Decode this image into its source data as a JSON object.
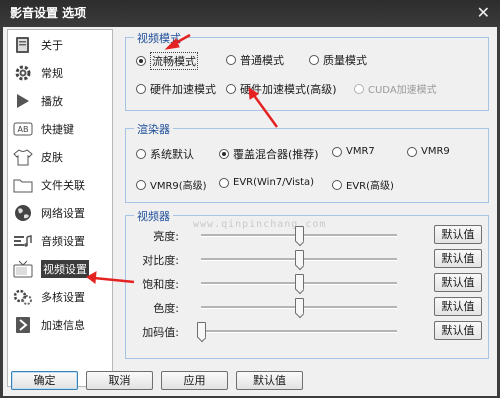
{
  "window": {
    "title": "影音设置 选项",
    "close_glyph": "✕"
  },
  "sidebar": {
    "items": [
      {
        "label": "关于",
        "icon": "about-icon"
      },
      {
        "label": "常规",
        "icon": "gear-icon"
      },
      {
        "label": "播放",
        "icon": "play-icon"
      },
      {
        "label": "快捷键",
        "icon": "keyboard-icon"
      },
      {
        "label": "皮肤",
        "icon": "shirt-icon"
      },
      {
        "label": "文件关联",
        "icon": "folder-icon"
      },
      {
        "label": "网络设置",
        "icon": "globe-icon"
      },
      {
        "label": "音频设置",
        "icon": "audio-icon"
      },
      {
        "label": "视频设置",
        "icon": "tv-icon"
      },
      {
        "label": "多核设置",
        "icon": "multicore-icon"
      },
      {
        "label": "加速信息",
        "icon": "accelerate-icon"
      }
    ],
    "active_index": 8
  },
  "video_mode": {
    "title": "视频模式",
    "options": [
      "流畅模式",
      "普通模式",
      "质量模式",
      "硬件加速模式",
      "硬件加速模式(高级)",
      "CUDA加速模式"
    ],
    "selected": "流畅模式",
    "disabled": [
      "CUDA加速模式"
    ]
  },
  "renderer": {
    "title": "渲染器",
    "options": [
      "系统默认",
      "覆盖混合器(推荐)",
      "VMR7",
      "VMR9",
      "VMR9(高级)",
      "EVR(Win7/Vista)",
      "EVR(高级)"
    ],
    "selected": "覆盖混合器(推荐)"
  },
  "video_adjust": {
    "title": "视频器",
    "sliders": [
      {
        "label": "亮度:",
        "value": 0.5,
        "button": "默认值"
      },
      {
        "label": "对比度:",
        "value": 0.5,
        "button": "默认值"
      },
      {
        "label": "饱和度:",
        "value": 0.5,
        "button": "默认值"
      },
      {
        "label": "色度:",
        "value": 0.5,
        "button": "默认值"
      },
      {
        "label": "加码值:",
        "value": 0.0,
        "button": "默认值"
      }
    ]
  },
  "watermark": "www.qinpinchang.com",
  "footer": {
    "ok": "确定",
    "cancel": "取消",
    "apply": "应用",
    "default": "默认值"
  },
  "colors": {
    "group_title": "#1f4e9a",
    "arrow": "#e52222",
    "titlebar": "#2d2d2d"
  }
}
